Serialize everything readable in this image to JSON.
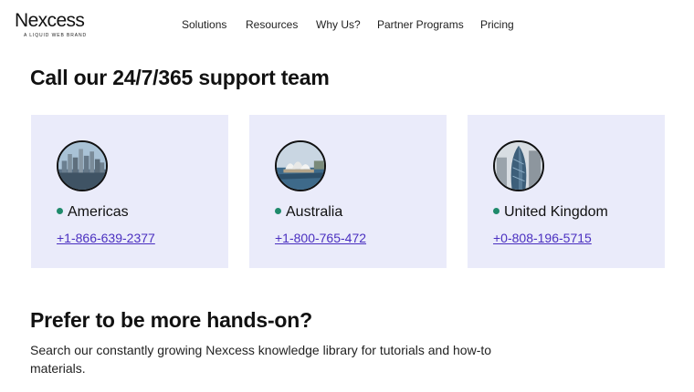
{
  "brand": {
    "name": "Nexcess",
    "tagline": "A LIQUID WEB BRAND"
  },
  "nav": {
    "items": [
      "Solutions",
      "Resources",
      "Why Us?",
      "Partner Programs",
      "Pricing"
    ]
  },
  "support": {
    "title": "Call our 24/7/365 support team",
    "regions": [
      {
        "name": "Americas",
        "phone": "+1-866-639-2377",
        "photo_icon": "city-skyline-photo"
      },
      {
        "name": "Australia",
        "phone": "+1-800-765-472",
        "photo_icon": "opera-house-photo"
      },
      {
        "name": "United Kingdom",
        "phone": "+0-808-196-5715",
        "photo_icon": "gherkin-tower-photo"
      }
    ],
    "status_color": "#1f8a6b",
    "card_color": "#eaebfa",
    "link_color": "#4a2fc0"
  },
  "handson": {
    "title": "Prefer to be more hands-on?",
    "description": "Search our constantly growing Nexcess knowledge library for tutorials and how-to materials."
  }
}
